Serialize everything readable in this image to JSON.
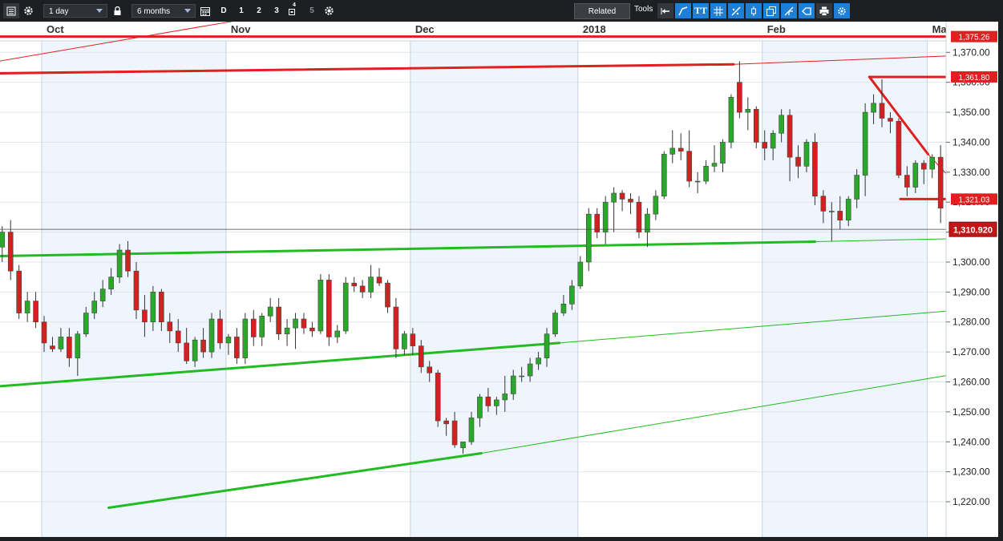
{
  "toolbar": {
    "interval": "1 day",
    "range": "6 months",
    "period_buttons": [
      "D",
      "1",
      "2",
      "3",
      "4",
      "5"
    ],
    "related_label": "Related",
    "tools_label": "Tools",
    "tt_label": "TT",
    "icons": [
      "chart-list-icon",
      "gear-icon",
      "lock-icon",
      "calendar-icon",
      "settings-icon",
      "arrow-icon",
      "line-tool-icon",
      "text-tool-icon",
      "grid-icon",
      "drawing-icon",
      "candle-icon",
      "clone-icon",
      "fork-icon",
      "eraser-icon",
      "print-icon",
      "tools-settings-icon"
    ]
  },
  "chart_data": {
    "type": "candlestick",
    "month_labels": [
      {
        "label": "Oct",
        "date": "2017-10-02"
      },
      {
        "label": "Nov",
        "date": "2017-11-01"
      },
      {
        "label": "Dec",
        "date": "2017-12-01"
      },
      {
        "label": "2018",
        "date": "2018-01-02"
      },
      {
        "label": "Feb",
        "date": "2018-02-01"
      },
      {
        "label": "Mar",
        "date": "2018-03-01"
      }
    ],
    "y_ticks": [
      "1,220.00",
      "1,230.00",
      "1,240.00",
      "1,250.00",
      "1,260.00",
      "1,270.00",
      "1,280.00",
      "1,290.00",
      "1,300.00",
      "1,310.00",
      "1,320.00",
      "1,330.00",
      "1,340.00",
      "1,350.00",
      "1,360.00",
      "1,370.00"
    ],
    "ylim": [
      1218,
      1380
    ],
    "last_price": "1,310.920",
    "price_labels": [
      {
        "text": "1,375.26",
        "value": 1375.26,
        "color": "#e02020"
      },
      {
        "text": "1,361.80",
        "value": 1361.8,
        "color": "#e02020"
      },
      {
        "text": "1,321.03",
        "value": 1321.03,
        "color": "#e02020"
      }
    ],
    "colors": {
      "up": "#2aa82a",
      "down": "#d42020",
      "support": "#22bb22",
      "resistance": "#e02020",
      "shade": "#eef5fc"
    },
    "ohlc": [
      [
        1305.0,
        1312.0,
        1300.0,
        1310.0
      ],
      [
        1310.0,
        1314.0,
        1294.0,
        1297.0
      ],
      [
        1297.0,
        1299.0,
        1281.0,
        1283.0
      ],
      [
        1283.0,
        1290.0,
        1280.0,
        1287.0
      ],
      [
        1287.0,
        1290.0,
        1278.0,
        1280.0
      ],
      [
        1280.0,
        1282.0,
        1270.0,
        1273.0
      ],
      [
        1272.0,
        1275.0,
        1270.0,
        1271.0
      ],
      [
        1271.0,
        1278.0,
        1270.0,
        1275.0
      ],
      [
        1275.0,
        1278.0,
        1265.0,
        1268.0
      ],
      [
        1268.0,
        1277.0,
        1262.0,
        1276.0
      ],
      [
        1276.0,
        1285.0,
        1275.0,
        1283.0
      ],
      [
        1283.0,
        1290.0,
        1281.0,
        1287.0
      ],
      [
        1287.0,
        1294.0,
        1285.0,
        1291.0
      ],
      [
        1291.0,
        1298.0,
        1289.0,
        1295.0
      ],
      [
        1295.0,
        1306.0,
        1293.0,
        1304.0
      ],
      [
        1304.0,
        1307.0,
        1295.0,
        1297.0
      ],
      [
        1297.0,
        1300.0,
        1281.0,
        1284.0
      ],
      [
        1284.0,
        1289.0,
        1275.0,
        1280.0
      ],
      [
        1280.0,
        1292.0,
        1277.0,
        1290.0
      ],
      [
        1290.0,
        1291.0,
        1277.0,
        1280.0
      ],
      [
        1280.0,
        1283.0,
        1273.0,
        1277.0
      ],
      [
        1277.0,
        1281.0,
        1270.0,
        1273.0
      ],
      [
        1273.0,
        1278.0,
        1266.0,
        1267.0
      ],
      [
        1267.0,
        1275.0,
        1265.0,
        1274.0
      ],
      [
        1274.0,
        1278.0,
        1268.0,
        1270.0
      ],
      [
        1270.0,
        1283.0,
        1268.0,
        1281.0
      ],
      [
        1281.0,
        1284.0,
        1271.0,
        1273.0
      ],
      [
        1273.0,
        1276.0,
        1269.0,
        1275.0
      ],
      [
        1275.0,
        1278.0,
        1266.0,
        1268.0
      ],
      [
        1268.0,
        1283.0,
        1266.0,
        1281.0
      ],
      [
        1281.0,
        1284.0,
        1272.0,
        1275.0
      ],
      [
        1275.0,
        1283.0,
        1272.0,
        1282.0
      ],
      [
        1282.0,
        1288.0,
        1280.0,
        1285.0
      ],
      [
        1285.0,
        1288.0,
        1274.0,
        1276.0
      ],
      [
        1276.0,
        1281.0,
        1272.0,
        1278.0
      ],
      [
        1278.0,
        1283.0,
        1271.0,
        1281.0
      ],
      [
        1281.0,
        1283.0,
        1276.0,
        1278.0
      ],
      [
        1278.0,
        1280.0,
        1275.0,
        1277.0
      ],
      [
        1277.0,
        1296.0,
        1276.0,
        1294.0
      ],
      [
        1294.0,
        1296.0,
        1272.0,
        1275.0
      ],
      [
        1275.0,
        1279.0,
        1273.0,
        1277.0
      ],
      [
        1277.0,
        1295.0,
        1276.0,
        1293.0
      ],
      [
        1293.0,
        1295.0,
        1290.0,
        1292.0
      ],
      [
        1292.0,
        1294.0,
        1288.0,
        1290.0
      ],
      [
        1290.0,
        1299.0,
        1288.0,
        1295.0
      ],
      [
        1295.0,
        1298.0,
        1292.0,
        1293.0
      ],
      [
        1293.0,
        1294.0,
        1283.0,
        1285.0
      ],
      [
        1285.0,
        1288.0,
        1268.0,
        1271.0
      ],
      [
        1271.0,
        1277.0,
        1269.0,
        1276.0
      ],
      [
        1276.0,
        1278.0,
        1269.0,
        1272.0
      ],
      [
        1272.0,
        1274.0,
        1263.0,
        1265.0
      ],
      [
        1265.0,
        1267.0,
        1260.0,
        1263.0
      ],
      [
        1263.0,
        1264.0,
        1245.0,
        1247.0
      ],
      [
        1247.0,
        1248.0,
        1242.0,
        1246.0
      ],
      [
        1247.0,
        1250.0,
        1238.0,
        1239.0
      ],
      [
        1238.0,
        1240.0,
        1236.0,
        1240.0
      ],
      [
        1240.0,
        1250.0,
        1239.0,
        1248.0
      ],
      [
        1248.0,
        1256.0,
        1245.0,
        1255.0
      ],
      [
        1255.0,
        1258.0,
        1250.0,
        1252.0
      ],
      [
        1252.0,
        1255.0,
        1249.0,
        1254.0
      ],
      [
        1254.0,
        1262.0,
        1250.0,
        1256.0
      ],
      [
        1256.0,
        1264.0,
        1254.0,
        1262.0
      ],
      [
        1262.0,
        1265.0,
        1260.0,
        1262.0
      ],
      [
        1262.0,
        1268.0,
        1260.0,
        1266.0
      ],
      [
        1266.0,
        1270.0,
        1264.0,
        1268.0
      ],
      [
        1268.0,
        1278.0,
        1265.0,
        1276.0
      ],
      [
        1276.0,
        1284.0,
        1275.0,
        1283.0
      ],
      [
        1283.0,
        1289.0,
        1282.0,
        1286.0
      ],
      [
        1286.0,
        1294.0,
        1284.0,
        1292.0
      ],
      [
        1292.0,
        1302.0,
        1291.0,
        1300.0
      ],
      [
        1300.0,
        1318.0,
        1297.0,
        1316.0
      ],
      [
        1316.0,
        1318.0,
        1308.0,
        1310.0
      ],
      [
        1310.0,
        1322.0,
        1306.0,
        1320.0
      ],
      [
        1320.0,
        1325.0,
        1310.0,
        1323.0
      ],
      [
        1323.0,
        1324.0,
        1317.0,
        1321.0
      ],
      [
        1321.0,
        1323.0,
        1316.0,
        1320.0
      ],
      [
        1320.0,
        1322.0,
        1308.0,
        1310.0
      ],
      [
        1310.0,
        1318.0,
        1305.0,
        1316.0
      ],
      [
        1316.0,
        1324.0,
        1314.0,
        1322.0
      ],
      [
        1322.0,
        1337.0,
        1321.0,
        1336.0
      ],
      [
        1336.0,
        1344.0,
        1333.0,
        1338.0
      ],
      [
        1338.0,
        1343.0,
        1334.0,
        1337.0
      ],
      [
        1337.0,
        1344.0,
        1325.0,
        1327.0
      ],
      [
        1327.0,
        1330.0,
        1323.0,
        1327.0
      ],
      [
        1327.0,
        1334.0,
        1326.0,
        1332.0
      ],
      [
        1332.0,
        1339.0,
        1330.0,
        1333.0
      ],
      [
        1333.0,
        1341.0,
        1330.0,
        1340.0
      ],
      [
        1340.0,
        1356.0,
        1338.0,
        1355.0
      ],
      [
        1360.0,
        1367.0,
        1348.0,
        1350.0
      ],
      [
        1350.0,
        1355.0,
        1344.0,
        1351.0
      ],
      [
        1351.0,
        1352.0,
        1338.0,
        1340.0
      ],
      [
        1340.0,
        1344.0,
        1334.0,
        1338.0
      ],
      [
        1338.0,
        1344.0,
        1334.0,
        1343.0
      ],
      [
        1343.0,
        1351.0,
        1340.0,
        1349.0
      ],
      [
        1349.0,
        1351.0,
        1327.0,
        1335.0
      ],
      [
        1335.0,
        1339.0,
        1328.0,
        1332.0
      ],
      [
        1332.0,
        1341.0,
        1330.0,
        1340.0
      ],
      [
        1340.0,
        1343.0,
        1319.0,
        1322.0
      ],
      [
        1322.0,
        1324.0,
        1313.0,
        1317.0
      ],
      [
        1317.0,
        1320.0,
        1307.0,
        1317.0
      ],
      [
        1317.0,
        1322.0,
        1311.0,
        1314.0
      ],
      [
        1314.0,
        1322.0,
        1312.0,
        1321.0
      ],
      [
        1321.0,
        1331.0,
        1318.0,
        1329.0
      ],
      [
        1329.0,
        1353.0,
        1322.0,
        1350.0
      ],
      [
        1350.0,
        1356.0,
        1346.0,
        1353.0
      ],
      [
        1353.0,
        1361.0,
        1345.0,
        1348.0
      ],
      [
        1348.0,
        1350.0,
        1343.0,
        1347.0
      ],
      [
        1347.0,
        1348.0,
        1328.0,
        1329.0
      ],
      [
        1329.0,
        1332.0,
        1322.0,
        1325.0
      ],
      [
        1325.0,
        1334.0,
        1323.0,
        1333.0
      ],
      [
        1333.0,
        1334.0,
        1326.0,
        1331.0
      ],
      [
        1331.0,
        1336.0,
        1328.0,
        1335.0
      ],
      [
        1335.0,
        1339.0,
        1313.0,
        1318.0
      ],
      [
        1318.0,
        1322.0,
        1314.0,
        1317.0
      ],
      [
        1317.0,
        1319.0,
        1306.0,
        1311.0
      ]
    ]
  }
}
